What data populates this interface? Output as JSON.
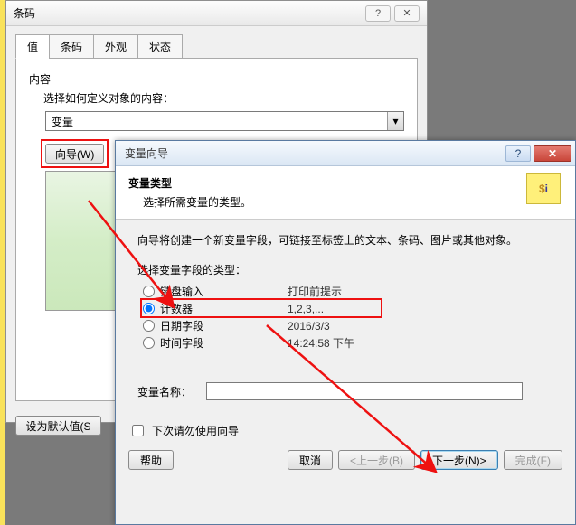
{
  "dlg1": {
    "title": "条码",
    "tabs": {
      "value": "值",
      "barcode": "条码",
      "appearance": "外观",
      "status": "状态"
    },
    "content_label": "内容",
    "define_label": "选择如何定义对象的内容：",
    "dropdown_value": "变量",
    "wizard_btn": "向导(W)",
    "set_default_btn": "设为默认值(S"
  },
  "dlg2": {
    "title": "变量向导",
    "header": "变量类型",
    "subheader": "选择所需变量的类型。",
    "intro": "向导将创建一个新变量字段，可链接至标签上的文本、条码、图片或其他对象。",
    "type_label": "选择变量字段的类型：",
    "options": {
      "keyboard": {
        "label": "键盘输入",
        "example": "打印前提示"
      },
      "counter": {
        "label": "计数器",
        "example": "1,2,3,..."
      },
      "date": {
        "label": "日期字段",
        "example": "2016/3/3"
      },
      "time": {
        "label": "时间字段",
        "example": "14:24:58 下午"
      }
    },
    "varname_label": "变量名称：",
    "varname_value": "",
    "dont_show": "下次请勿使用向导",
    "buttons": {
      "help": "帮助",
      "cancel": "取消",
      "back": "<上一步(B)",
      "next": "下一步(N)>",
      "finish": "完成(F)"
    }
  },
  "icons": {
    "si": "$i"
  }
}
